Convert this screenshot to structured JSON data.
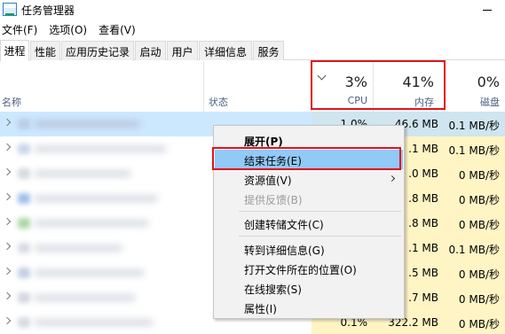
{
  "window": {
    "title": "任务管理器"
  },
  "menu": [
    {
      "label": "文件(F)"
    },
    {
      "label": "选项(O)"
    },
    {
      "label": "查看(V)"
    }
  ],
  "tabs": [
    {
      "label": "进程",
      "active": true
    },
    {
      "label": "性能"
    },
    {
      "label": "应用历史记录"
    },
    {
      "label": "启动"
    },
    {
      "label": "用户"
    },
    {
      "label": "详细信息"
    },
    {
      "label": "服务"
    }
  ],
  "columns": {
    "name": "名称",
    "status": "状态",
    "cpu": {
      "percent": "3%",
      "label": "CPU"
    },
    "memory": {
      "percent": "41%",
      "label": "内存"
    },
    "disk": {
      "percent": "0%",
      "label": "磁盘"
    }
  },
  "rows": [
    {
      "cpu": "1.0%",
      "memory": "46.6 MB",
      "disk": "0.1 MB/秒",
      "selected": true
    },
    {
      "cpu": "",
      "memory": ".1 MB",
      "disk": "0.1 MB/秒"
    },
    {
      "cpu": "",
      "memory": ".0 MB",
      "disk": "0 MB/秒"
    },
    {
      "cpu": "",
      "memory": ".8 MB",
      "disk": "0 MB/秒"
    },
    {
      "cpu": "",
      "memory": ".8 MB",
      "disk": "0 MB/秒"
    },
    {
      "cpu": "",
      "memory": ".1 MB",
      "disk": "0.1 MB/秒"
    },
    {
      "cpu": "",
      "memory": ".5 MB",
      "disk": "0 MB/秒"
    },
    {
      "cpu": "",
      "memory": ".7 MB",
      "disk": "0 MB/秒"
    },
    {
      "cpu": "0.1%",
      "memory": "322.2 MB",
      "disk": "0 MB/秒"
    }
  ],
  "context_menu": {
    "expand": "展开(P)",
    "end_task": "结束任务(E)",
    "resource_values": "资源值(V)",
    "feedback": "提供反馈(B)",
    "create_dump": "创建转储文件(C)",
    "go_to_details": "转到详细信息(G)",
    "open_location": "打开文件所在的位置(O)",
    "search_online": "在线搜索(S)",
    "properties": "属性(I)"
  },
  "colors": {
    "highlight_box": "#e0131b",
    "selected_row": "#cce8ff",
    "menu_hover": "#91c9f7",
    "usage_cell": "#fff4c4"
  }
}
